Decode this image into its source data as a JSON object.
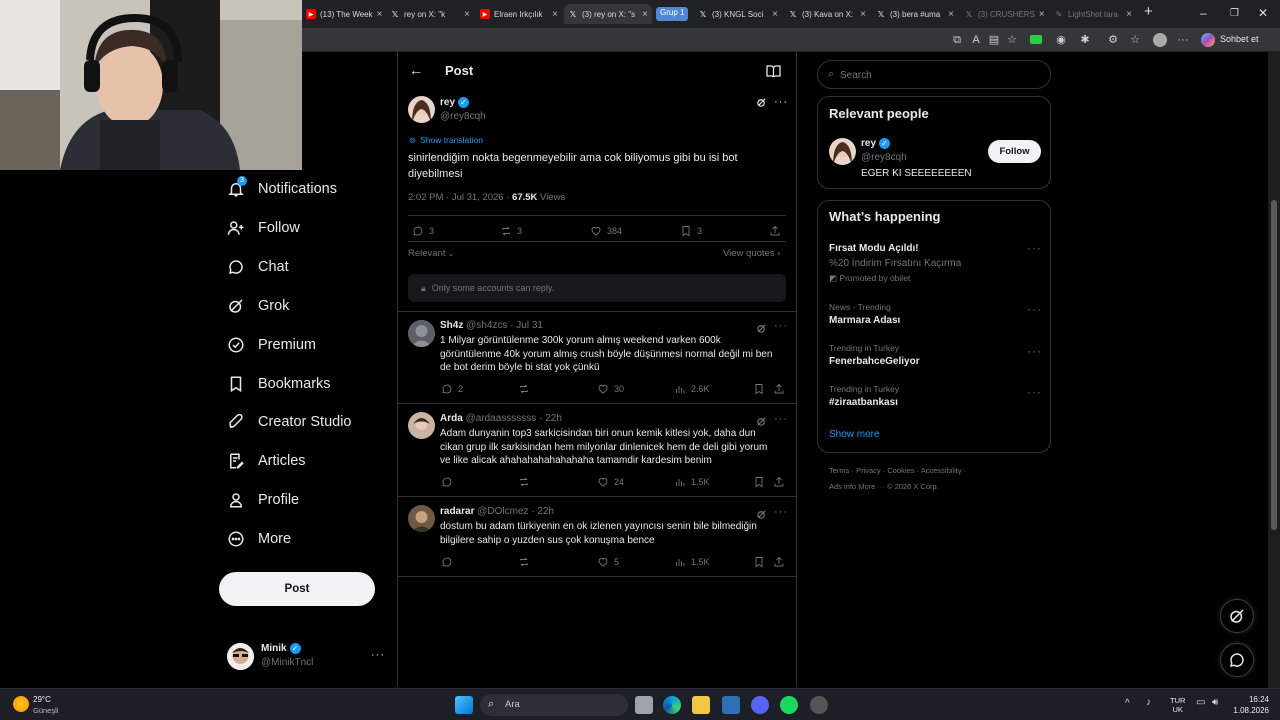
{
  "browser": {
    "tabs": [
      {
        "label": "(13) The Week",
        "icon": "youtube-icon"
      },
      {
        "label": "rey on X: \"k",
        "icon": "x-icon"
      },
      {
        "label": "Elraen Irkçılık",
        "icon": "youtube-icon"
      },
      {
        "label": "(3) rey on X: \"s",
        "icon": "x-icon"
      },
      {
        "label": "(3) KNGL Soci",
        "icon": "x-icon"
      },
      {
        "label": "(3) Kava on X:",
        "icon": "x-icon"
      },
      {
        "label": "(3) bera #uma",
        "icon": "x-icon"
      },
      {
        "label": "(3) CRUSHERS",
        "icon": "x-icon"
      },
      {
        "label": "LightShot tara",
        "icon": "feather-icon"
      }
    ],
    "group_label": "Grup 1",
    "chat_label": "Sohbet et"
  },
  "nav": {
    "items": [
      {
        "label": "Notifications",
        "badge": "3"
      },
      {
        "label": "Follow"
      },
      {
        "label": "Chat"
      },
      {
        "label": "Grok"
      },
      {
        "label": "Premium"
      },
      {
        "label": "Bookmarks"
      },
      {
        "label": "Creator Studio"
      },
      {
        "label": "Articles"
      },
      {
        "label": "Profile"
      },
      {
        "label": "More"
      }
    ],
    "post_button": "Post",
    "account": {
      "name": "Minik",
      "handle": "@MinikTncl"
    }
  },
  "post_header": {
    "title": "Post"
  },
  "post": {
    "name": "rey",
    "handle": "@rey8cqh",
    "show_translation": "Show translation",
    "text_line1": "sinirlendiğim nokta begenmeyebilir ama cok biliyomus gibi bu isi bot",
    "text_line2": "diyebilmesi",
    "time": "2:02 PM · Jul 31, 2026 · ",
    "views_count": "67.5K",
    "views_label": " Views",
    "replies": "3",
    "reposts": "3",
    "likes": "384",
    "bookmarks": "3",
    "sort_label": "Relevant",
    "view_quotes": "View quotes",
    "reply_restriction": "Only some accounts can reply."
  },
  "replies": [
    {
      "name": "Sh4z",
      "handle": "@sh4zcs",
      "time": "· Jul 31",
      "lines": [
        "1 Milyar görüntülenme 300k yorum almış weekend varken 600k",
        "görüntülenme 40k yorum almış crush böyle düşünmesi normal değil mi ben",
        "de bot derim böyle bi stat yok çünkü"
      ],
      "replies": "2",
      "reposts": "",
      "likes": "30",
      "views": "2.6K"
    },
    {
      "name": "Arda",
      "handle": "@ardaasssssss",
      "time": "· 22h",
      "lines": [
        "Adam dunyanin top3 sarkicisindan biri onun kemik kitlesi yok, daha dun",
        "cikan grup ilk sarkisindan hem milyonlar dinlenicek hem de deli gibi yorum",
        "ve like alicak ahahahahahahahaha tamamdir kardesim benim"
      ],
      "replies": "",
      "reposts": "",
      "likes": "24",
      "views": "1.5K"
    },
    {
      "name": "radarar",
      "handle": "@DOlcmez",
      "time": "· 22h",
      "lines": [
        "dostum bu adam türkiyenin en ok izlenen yayıncısı senin bile bilmediğin",
        "bilgilere sahip o yuzden sus çok konuşma bence"
      ],
      "replies": "",
      "reposts": "",
      "likes": "5",
      "views": "1.5K"
    }
  ],
  "search": {
    "placeholder": "Search"
  },
  "relevant_people": {
    "title": "Relevant people",
    "name": "rey",
    "handle": "@rey8cqh",
    "bio": "EGER KI SEEEEEEEEN",
    "follow": "Follow"
  },
  "happening": {
    "title": "What’s happening",
    "items": [
      {
        "title": "Fırsat Modu Açıldı!",
        "sub": "%20 İndirim Fırsatını Kaçırma",
        "meta": "Promoted by obilet"
      },
      {
        "meta": "News · Trending",
        "title": "Marmara Adası"
      },
      {
        "meta": "Trending in Turkey",
        "title": "FenerbahceGeliyor"
      },
      {
        "meta": "Trending in Turkey",
        "title": "#ziraatbankası"
      }
    ],
    "show_more": "Show more"
  },
  "footer": {
    "row1": [
      "Terms",
      "Privacy",
      "Cookies",
      "Accessibility"
    ],
    "row2": [
      "Ads info",
      "More ···",
      "© 2026 X Corp."
    ]
  },
  "taskbar": {
    "weather_temp": "29°C",
    "weather_desc": "Güneşli",
    "search_label": "Ara",
    "lang1": "TUR",
    "lang2": "UK",
    "time": "16:24",
    "date": "1.08.2026"
  }
}
